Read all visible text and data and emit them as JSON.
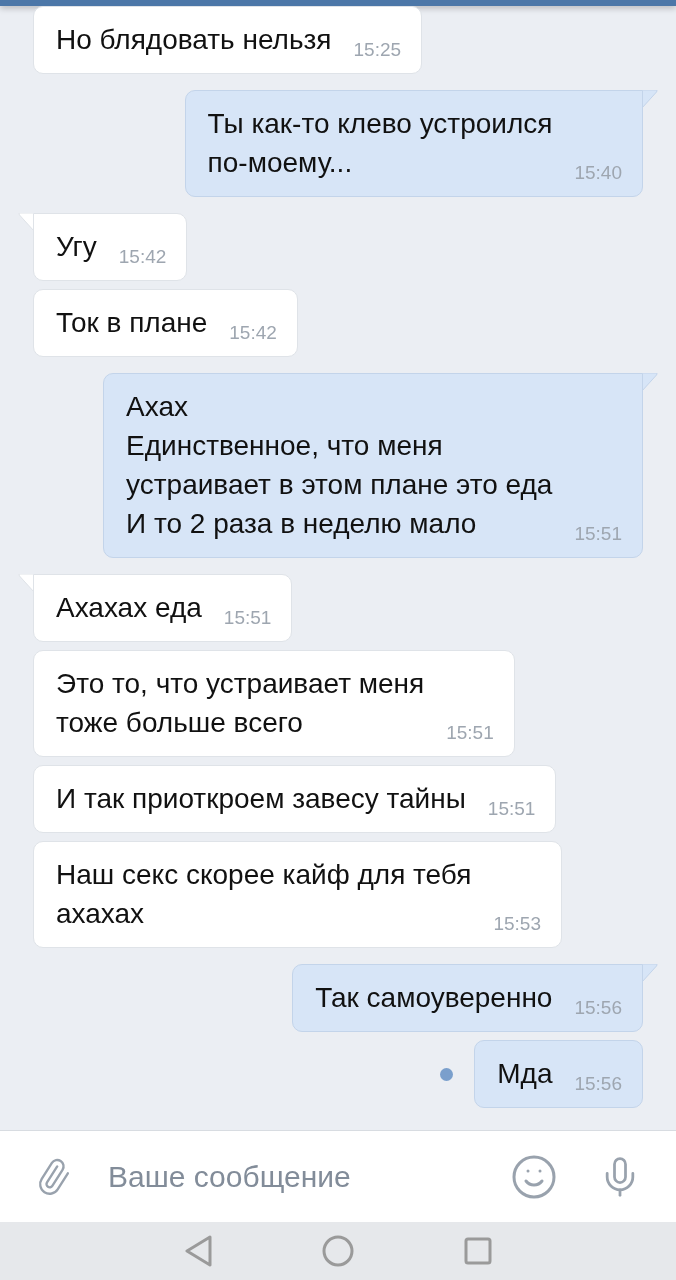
{
  "messages": [
    {
      "kind": "in",
      "tail": false,
      "text": "Но блядовать нельзя",
      "time": "15:25",
      "unread": false
    },
    {
      "kind": "out",
      "tail": true,
      "text": "Ты как-то клево устроился\nпо-моему...",
      "time": "15:40",
      "unread": false
    },
    {
      "kind": "in",
      "tail": true,
      "text": "Угу",
      "time": "15:42",
      "unread": false
    },
    {
      "kind": "in",
      "tail": false,
      "text": "Ток в плане",
      "time": "15:42",
      "unread": false
    },
    {
      "kind": "out",
      "tail": true,
      "text": "Ахах\nЕдинственное, что меня\nустраивает в этом плане это еда\nИ то 2 раза в неделю мало",
      "time": "15:51",
      "unread": false
    },
    {
      "kind": "in",
      "tail": true,
      "text": "Ахахах еда",
      "time": "15:51",
      "unread": false
    },
    {
      "kind": "in",
      "tail": false,
      "text": "Это то, что устраивает меня\nтоже больше всего",
      "time": "15:51",
      "unread": false
    },
    {
      "kind": "in",
      "tail": false,
      "text": "И так приоткроем завесу тайны",
      "time": "15:51",
      "unread": false
    },
    {
      "kind": "in",
      "tail": false,
      "text": "Наш секс скорее кайф для тебя\nахахах",
      "time": "15:53",
      "unread": false
    },
    {
      "kind": "out",
      "tail": true,
      "text": "Так самоуверенно",
      "time": "15:56",
      "unread": false
    },
    {
      "kind": "out",
      "tail": false,
      "text": "Мда",
      "time": "15:56",
      "unread": true
    }
  ],
  "composer": {
    "placeholder": "Ваше сообщение"
  }
}
